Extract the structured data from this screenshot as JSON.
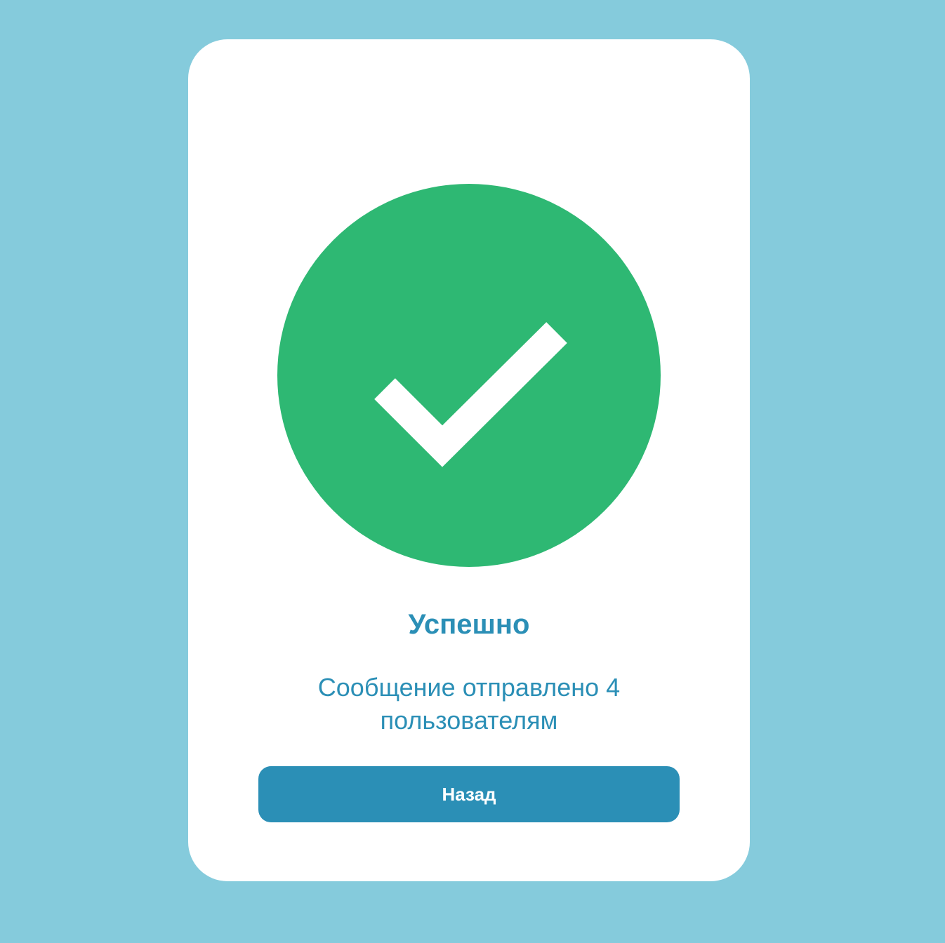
{
  "colors": {
    "page_background": "#85cbdc",
    "card_background": "#ffffff",
    "success_green": "#2eb873",
    "accent_blue": "#2b8fb6"
  },
  "status_icon": "checkmark-icon",
  "dialog": {
    "title": "Успешно",
    "message": "Сообщение отправлено 4 пользователям",
    "back_button_label": "Назад"
  }
}
